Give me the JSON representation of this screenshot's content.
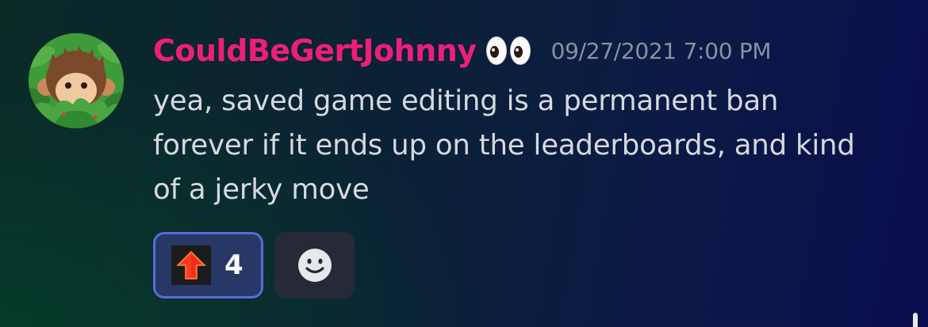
{
  "message": {
    "username": "CouldBeGertJohnny",
    "username_color": "#eb1f79",
    "user_badge_icon": "eyes-emoji-icon",
    "timestamp": "09/27/2021 7:00 PM",
    "content": "yea, saved game editing is a permanent ban forever if it ends up on the leaderboards, and kind of a jerky move",
    "avatar_icon": "monkey-in-bush-avatar"
  },
  "reactions": [
    {
      "emoji_icon": "red-up-arrow-emoji-icon",
      "count": "4",
      "selected": true
    }
  ],
  "add_reaction": {
    "icon": "smiley-add-reaction-icon"
  },
  "colors": {
    "accent": "#5a6ad9",
    "reaction_bg": "#283866",
    "text": "#d6d9de",
    "timestamp": "#8a90a0"
  }
}
